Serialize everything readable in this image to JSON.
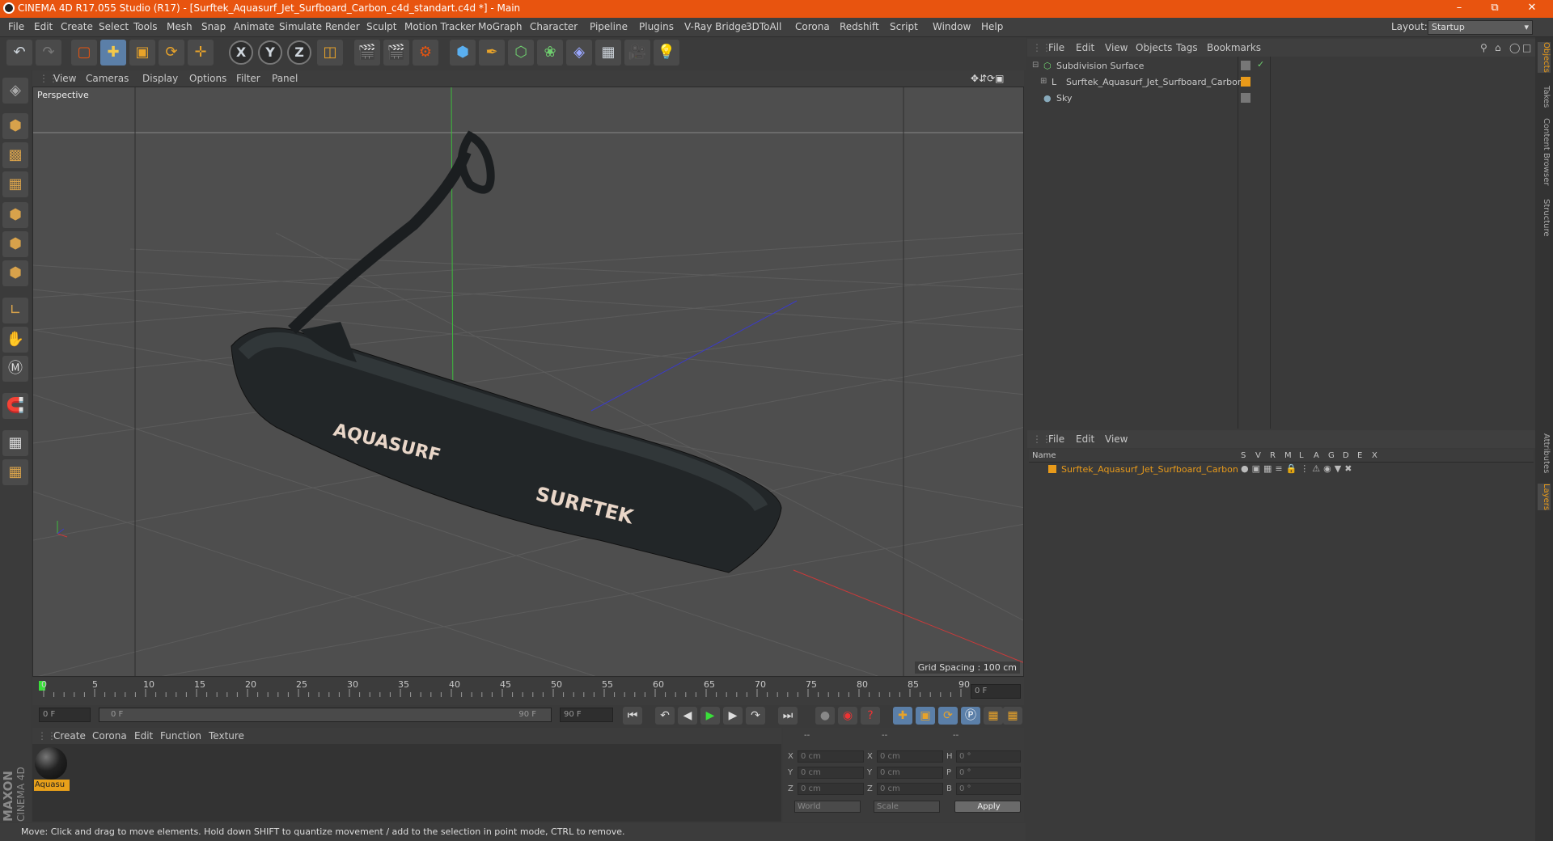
{
  "app": {
    "title": "CINEMA 4D R17.055 Studio (R17) - [Surftek_Aquasurf_Jet_Surfboard_Carbon_c4d_standart.c4d *] - Main",
    "layout_label": "Layout:",
    "layout_value": "Startup",
    "accent_color": "#e8540f"
  },
  "menu": [
    "File",
    "Edit",
    "Create",
    "Select",
    "Tools",
    "Mesh",
    "Snap",
    "Animate",
    "Simulate",
    "Render",
    "Sculpt",
    "Motion Tracker",
    "MoGraph",
    "Character",
    "Pipeline",
    "Plugins",
    "V-Ray Bridge",
    "3DToAll",
    "Corona",
    "Redshift",
    "Script",
    "Window",
    "Help"
  ],
  "toolbar": {
    "icons": [
      "undo-icon",
      "redo-icon",
      "live-selection-icon",
      "move-icon",
      "scale-icon",
      "rotate-icon",
      "move-all-icon",
      "x-axis-lock",
      "y-axis-lock",
      "z-axis-lock",
      "coordinate-system-icon",
      "render-view-icon",
      "render-picture-viewer-icon",
      "render-settings-icon",
      "cube-icon",
      "pen-spline-icon",
      "subdivision-icon",
      "cloner-icon",
      "deformer-icon",
      "floor-icon",
      "camera-icon",
      "light-icon"
    ],
    "axis_x": "X",
    "axis_y": "Y",
    "axis_z": "Z"
  },
  "viewport": {
    "menu": [
      "View",
      "Cameras",
      "Display",
      "Options",
      "Filter",
      "Panel"
    ],
    "label": "Perspective",
    "grid_spacing": "Grid Spacing : 100 cm"
  },
  "timeline": {
    "ticks": [
      "0",
      "5",
      "10",
      "15",
      "20",
      "25",
      "30",
      "35",
      "40",
      "45",
      "50",
      "55",
      "60",
      "65",
      "70",
      "75",
      "80",
      "85",
      "90"
    ],
    "current_frame": "0 F",
    "start_field": "0 F",
    "slider_left": "0 F",
    "slider_right": "90 F",
    "end_field": "90 F"
  },
  "materials": {
    "menu": [
      "Create",
      "Corona",
      "Edit",
      "Function",
      "Texture"
    ],
    "items": [
      {
        "name": "Aquasu"
      }
    ]
  },
  "coords": {
    "headers": [
      "--",
      "--",
      "--"
    ],
    "rows": [
      {
        "a": "X",
        "av": "0 cm",
        "b": "X",
        "bv": "0 cm",
        "c": "H",
        "cv": "0 °"
      },
      {
        "a": "Y",
        "av": "0 cm",
        "b": "Y",
        "bv": "0 cm",
        "c": "P",
        "cv": "0 °"
      },
      {
        "a": "Z",
        "av": "0 cm",
        "b": "Z",
        "bv": "0 cm",
        "c": "B",
        "cv": "0 °"
      }
    ],
    "world": "World",
    "scale": "Scale",
    "apply": "Apply"
  },
  "status": "Move: Click and drag to move elements. Hold down SHIFT to quantize movement / add to the selection in point mode, CTRL to remove.",
  "object_manager": {
    "menu": [
      "File",
      "Edit",
      "View",
      "Objects",
      "Tags",
      "Bookmarks"
    ],
    "objects": [
      {
        "name": "Subdivision Surface",
        "icon": "subdivision-icon",
        "tag_color": "#6fcf6f",
        "indent": 0
      },
      {
        "name": "Surftek_Aquasurf_Jet_Surfboard_Carbon",
        "icon": "null-object-icon",
        "tag_color": "#e89a1a",
        "indent": 1
      },
      {
        "name": "Sky",
        "icon": "sky-icon",
        "tag_color": "",
        "indent": 0
      }
    ]
  },
  "layer_manager": {
    "menu": [
      "File",
      "Edit",
      "View"
    ],
    "columns": [
      "Name",
      "S",
      "V",
      "R",
      "M",
      "L",
      "A",
      "G",
      "D",
      "E",
      "X"
    ],
    "layers": [
      {
        "name": "Surftek_Aquasurf_Jet_Surfboard_Carbon",
        "color": "#e89a1a"
      }
    ]
  },
  "side_tabs": [
    "Objects",
    "Takes",
    "Content Browser",
    "Structure",
    "Attributes",
    "Layers"
  ],
  "brand": {
    "maxon": "MAXON",
    "c4d": "CINEMA 4D"
  }
}
